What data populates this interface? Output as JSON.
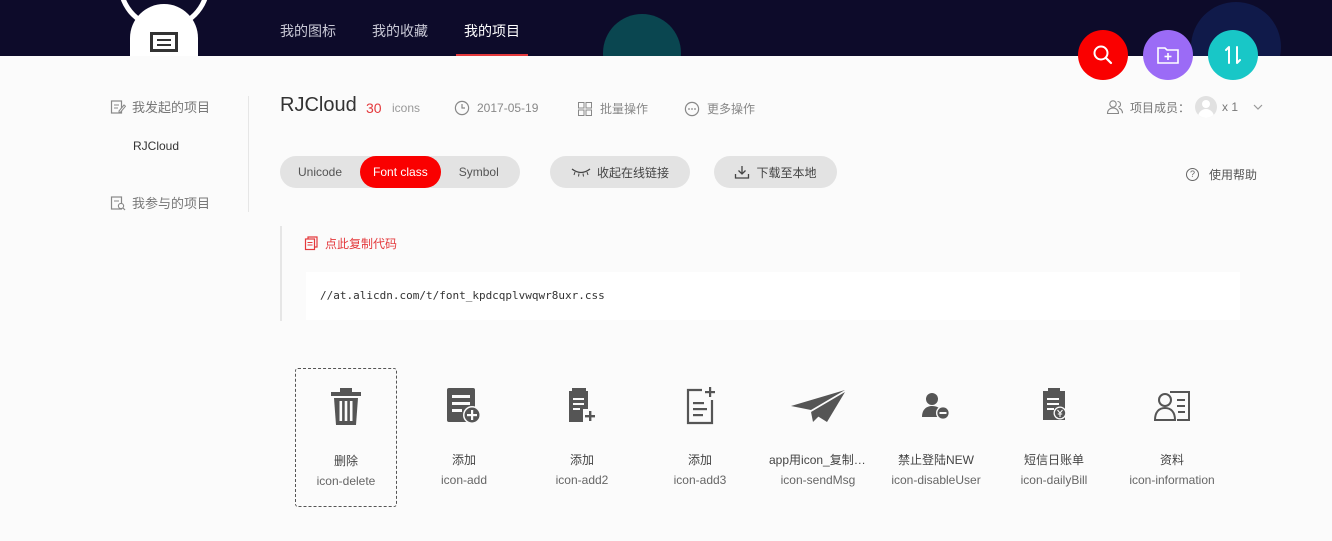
{
  "nav": {
    "items": [
      {
        "label": "我的图标",
        "active": false
      },
      {
        "label": "我的收藏",
        "active": false
      },
      {
        "label": "我的项目",
        "active": true
      }
    ]
  },
  "fab": {
    "search": {
      "icon": "search-icon",
      "color": "#fa0000"
    },
    "add_folder": {
      "icon": "folder-plus-icon",
      "color": "#9b6bf6"
    },
    "sort": {
      "icon": "sort-icon",
      "color": "#18c7c7"
    }
  },
  "sidebar": {
    "created_heading": "我发起的项目",
    "created_items": [
      "RJCloud"
    ],
    "joined_heading": "我参与的项目"
  },
  "project": {
    "name": "RJCloud",
    "icon_count": "30",
    "icon_count_unit": "icons",
    "date": "2017-05-19",
    "batch_label": "批量操作",
    "more_label": "更多操作",
    "members_label": "项目成员：",
    "members_count": "x 1"
  },
  "toolbar": {
    "tabs": [
      {
        "label": "Unicode",
        "active": false
      },
      {
        "label": "Font class",
        "active": true
      },
      {
        "label": "Symbol",
        "active": false
      }
    ],
    "collapse_link_label": "收起在线链接",
    "download_label": "下载至本地",
    "help_label": "使用帮助"
  },
  "code": {
    "copy_label": "点此复制代码",
    "url": "//at.alicdn.com/t/font_kpdcqplvwqwr8uxr.css"
  },
  "icons": [
    {
      "name": "删除",
      "code": "icon-delete",
      "icon": "trash-icon",
      "selected": true
    },
    {
      "name": "添加",
      "code": "icon-add",
      "icon": "list-add-icon",
      "selected": false
    },
    {
      "name": "添加",
      "code": "icon-add2",
      "icon": "document-add-icon",
      "selected": false
    },
    {
      "name": "添加",
      "code": "icon-add3",
      "icon": "file-add-icon",
      "selected": false
    },
    {
      "name": "app用icon_复制-...",
      "code": "icon-sendMsg",
      "icon": "paper-plane-icon",
      "selected": false
    },
    {
      "name": "禁止登陆NEW",
      "code": "icon-disableUser",
      "icon": "user-disable-icon",
      "selected": false
    },
    {
      "name": "短信日账单",
      "code": "icon-dailyBill",
      "icon": "daily-bill-icon",
      "selected": false
    },
    {
      "name": "资料",
      "code": "icon-information",
      "icon": "profile-card-icon",
      "selected": false
    }
  ],
  "colors": {
    "header_bg": "#0d0b2a",
    "accent": "#fa0000",
    "active_underline": "#e4393c"
  }
}
